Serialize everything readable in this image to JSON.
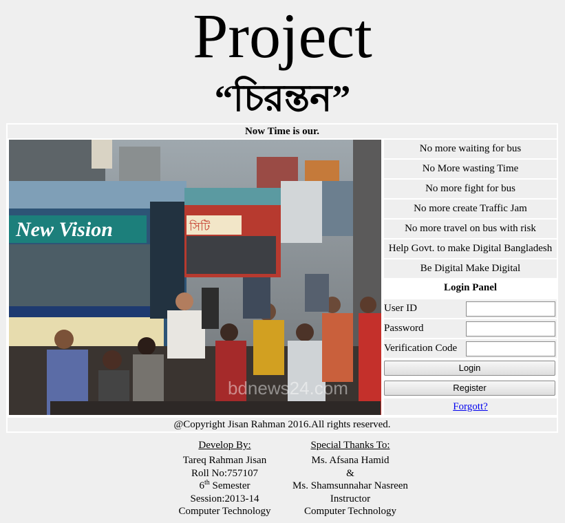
{
  "title": "Project",
  "subtitle": "“চিরন্তন”",
  "header": "Now Time is our.",
  "slogans": [
    "No more waiting for bus",
    "No More wasting Time",
    "No more fight for bus",
    "No more create Traffic Jam",
    "No more travel on bus with risk",
    "Help Govt. to make Digital Bangladesh",
    "Be Digital Make Digital"
  ],
  "login": {
    "title": "Login Panel",
    "user_id_label": "User ID",
    "password_label": "Password",
    "verification_label": "Verification Code",
    "login_button": "Login",
    "register_button": "Register",
    "forgot_link": "Forgott?"
  },
  "photo": {
    "bus_sign": "New Vision",
    "bus_sign_2": "সিটি",
    "watermark": "bdnews24.com"
  },
  "copyright": "@Copyright Jisan Rahman 2016.All rights reserved.",
  "developer": {
    "heading": "Develop By:",
    "name": "Tareq Rahman Jisan",
    "roll": "Roll No:757107",
    "semester_num": "6",
    "semester_sup": "th",
    "semester_word": " Semester",
    "session": "Session:2013-14",
    "department": "Computer Technology"
  },
  "thanks": {
    "heading": "Special Thanks To:",
    "person1": "Ms. Afsana Hamid",
    "and": "&",
    "person2": "Ms. Shamsunnahar Nasreen",
    "role": "Instructor",
    "department": "Computer Technology"
  }
}
